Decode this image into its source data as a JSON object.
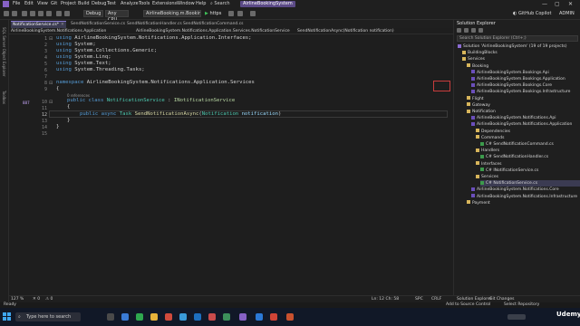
{
  "menu": {
    "items": [
      "File",
      "Edit",
      "View",
      "Git",
      "Project",
      "Build",
      "Debug",
      "Test",
      "Analyze",
      "Tools",
      "Extensions",
      "Window",
      "Help"
    ],
    "search_label": "Search",
    "solution_name": "AirlineBookingSystem"
  },
  "toolbar": {
    "config": "Debug",
    "platform": "Any CPU",
    "startup_project": "AirlineBooking.m.Bookings.Api",
    "run_target": "https",
    "copilot_label": "GitHub Copilot",
    "admin_label": "ADMIN"
  },
  "left_strip": [
    "SQL Server Object Explorer",
    "Toolbox",
    "Explorer"
  ],
  "tabs": [
    {
      "label": "NotificationService.cs*",
      "active": true
    },
    {
      "label": "SendNotificationService.cs",
      "active": false
    },
    {
      "label": "SendNotificationHandler.cs",
      "active": false
    },
    {
      "label": "SendNotificationCommand.cs",
      "active": false
    }
  ],
  "navbar": {
    "project": "AirlineBookingSystem.Notifications.Application",
    "type": "AirlineBookingSystem.Notifications.Application.Services.NotificationService",
    "member": "SendNotificationAsync(Notification notification)"
  },
  "code": {
    "line_numbers": [
      "1",
      "2",
      "3",
      "4",
      "5",
      "6",
      "7",
      "8",
      "9",
      "10",
      "11",
      "12",
      "13",
      "14",
      "15"
    ],
    "using_ns": [
      "AirlineBookingSystem.Notifications.Application.Interfaces;",
      "System;",
      "System.Collections.Generic;",
      "System.Linq;",
      "System.Text;",
      "System.Threading.Tasks;"
    ],
    "using_kw": "using",
    "namespace_kw": "namespace",
    "namespace_name": "AirlineBookingSystem.Notifications.Application.Services",
    "open_brace": "{",
    "close_brace": "}",
    "references": "0 references",
    "ref_count": "887",
    "class_kw": "public class",
    "class_name": "NotificationService",
    "colon": " : ",
    "interface_name": "INotificationService",
    "method_kw": "public async",
    "method_return": "Task",
    "method_name": "SendNotificationAsync",
    "method_paren_open": "(",
    "param_type": "Notification",
    "param_name": "notification",
    "method_paren_close": ")"
  },
  "editor_status": {
    "zoom": "127 %",
    "errors": "0",
    "warnings": "0",
    "position": "Ln: 12  Ch: 58",
    "spc": "SPC",
    "crlf": "CRLF"
  },
  "solution_explorer": {
    "title": "Solution Explorer",
    "search_placeholder": "Search Solution Explorer (Ctrl+;)",
    "tree": [
      {
        "label": "Solution 'AirlineBookingSystem' (19 of 19 projects)",
        "indent": 0,
        "icon": "solution-icon",
        "selected": false
      },
      {
        "label": "BuildingBlocks",
        "indent": 1,
        "icon": "folder-icon",
        "selected": false
      },
      {
        "label": "Services",
        "indent": 1,
        "icon": "folder-icon",
        "selected": false
      },
      {
        "label": "Booking",
        "indent": 2,
        "icon": "folder-icon",
        "selected": false
      },
      {
        "label": "AirlineBookingSystem.Bookings.Api",
        "indent": 3,
        "icon": "project-icon",
        "selected": false
      },
      {
        "label": "AirlineBookingSystem.Bookings.Application",
        "indent": 3,
        "icon": "project-icon",
        "selected": false
      },
      {
        "label": "AirlineBookingSystem.Bookings.Core",
        "indent": 3,
        "icon": "project-icon",
        "selected": false
      },
      {
        "label": "AirlineBookingSystem.Bookings.Infrastructure",
        "indent": 3,
        "icon": "project-icon",
        "selected": false
      },
      {
        "label": "Flight",
        "indent": 2,
        "icon": "folder-icon",
        "selected": false
      },
      {
        "label": "Gateway",
        "indent": 2,
        "icon": "folder-icon",
        "selected": false
      },
      {
        "label": "Notification",
        "indent": 2,
        "icon": "folder-icon",
        "selected": false
      },
      {
        "label": "AirlineBookingSystem.Notifications.Api",
        "indent": 3,
        "icon": "project-icon",
        "selected": false
      },
      {
        "label": "AirlineBookingSystem.Notifications.Application",
        "indent": 3,
        "icon": "project-icon",
        "selected": false
      },
      {
        "label": "Dependencies",
        "indent": 4,
        "icon": "folder-icon",
        "selected": false
      },
      {
        "label": "Commands",
        "indent": 4,
        "icon": "folder-icon",
        "selected": false
      },
      {
        "label": "C# SendNotificationCommand.cs",
        "indent": 5,
        "icon": "cs-file-icon",
        "selected": false
      },
      {
        "label": "Handlers",
        "indent": 4,
        "icon": "folder-icon",
        "selected": false
      },
      {
        "label": "C# SendNotificationHandler.cs",
        "indent": 5,
        "icon": "cs-file-icon",
        "selected": false
      },
      {
        "label": "Interfaces",
        "indent": 4,
        "icon": "folder-icon",
        "selected": false
      },
      {
        "label": "C# INotificationService.cs",
        "indent": 5,
        "icon": "cs-file-icon",
        "selected": false
      },
      {
        "label": "Services",
        "indent": 4,
        "icon": "folder-icon",
        "selected": false
      },
      {
        "label": "C# NotificationService.cs",
        "indent": 5,
        "icon": "cs-file-icon",
        "selected": true
      },
      {
        "label": "AirlineBookingSystem.Notifications.Core",
        "indent": 3,
        "icon": "project-icon",
        "selected": false
      },
      {
        "label": "AirlineBookingSystem.Notifications.Infrastructure",
        "indent": 3,
        "icon": "project-icon",
        "selected": false
      },
      {
        "label": "Payment",
        "indent": 2,
        "icon": "folder-icon",
        "selected": false
      }
    ],
    "footer_tabs": [
      "Solution Explorer",
      "Git Changes"
    ]
  },
  "statusbar": {
    "ready": "Ready",
    "add_source": "Add to Source Control",
    "select_repo": "Select Repository"
  },
  "taskbar": {
    "search_placeholder": "Type here to search",
    "brand": "Udemy"
  },
  "colors": {
    "accent": "#8b7cd6",
    "editor_bg": "#1e1e1e",
    "keyword": "#569cd6",
    "class": "#4ec9b0",
    "method": "#dcdcaa"
  }
}
